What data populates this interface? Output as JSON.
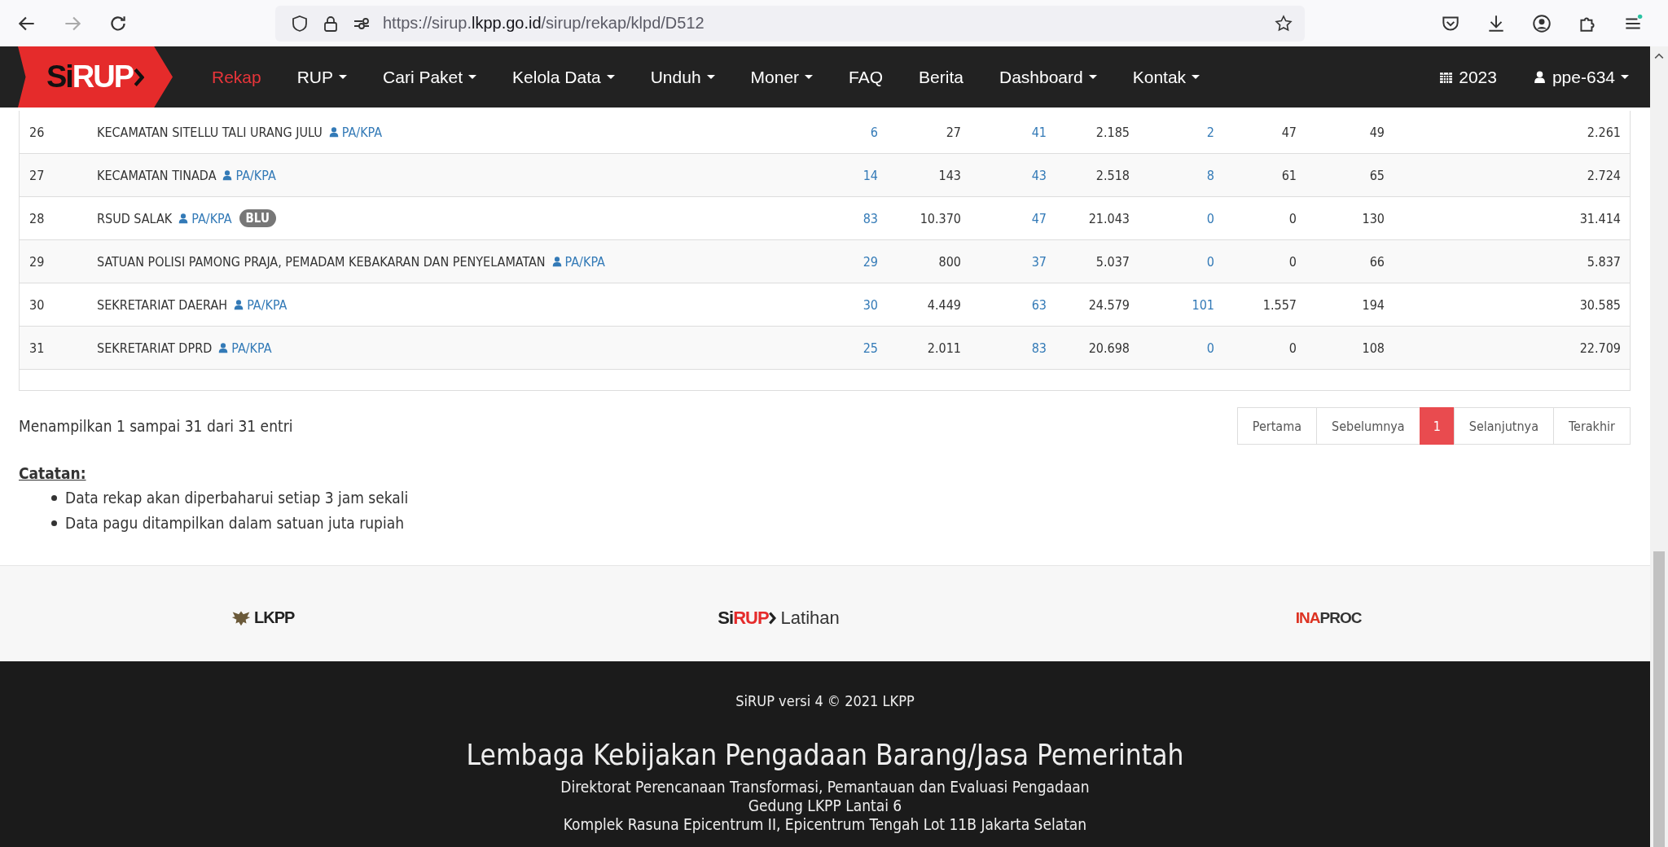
{
  "browser": {
    "url": "https://sirup.**lkpp.go.id**/sirup/rekap/klpd/D512",
    "back_disabled": false,
    "forward_disabled": true
  },
  "navbar": {
    "logo": {
      "dark": "Si",
      "light": "RUP"
    },
    "items": [
      {
        "label": "Rekap",
        "selected": true,
        "dropdown": false
      },
      {
        "label": "RUP",
        "selected": false,
        "dropdown": true
      },
      {
        "label": "Cari Paket",
        "selected": false,
        "dropdown": true
      },
      {
        "label": "Kelola Data",
        "selected": false,
        "dropdown": true
      },
      {
        "label": "Unduh",
        "selected": false,
        "dropdown": true
      },
      {
        "label": "Moner",
        "selected": false,
        "dropdown": true
      },
      {
        "label": "FAQ",
        "selected": false,
        "dropdown": false
      },
      {
        "label": "Berita",
        "selected": false,
        "dropdown": false
      },
      {
        "label": "Dashboard",
        "selected": false,
        "dropdown": true
      },
      {
        "label": "Kontak",
        "selected": false,
        "dropdown": true
      }
    ],
    "year": "2023",
    "user": "ppe-634"
  },
  "table": {
    "rows": [
      {
        "no": "26",
        "name": "KECAMATAN SITELLU TALI URANG JULU",
        "role": "PA/KPA",
        "cells": [
          {
            "text": "6",
            "kind": "link"
          },
          {
            "text": "27",
            "kind": "text"
          },
          {
            "text": "41",
            "kind": "link"
          },
          {
            "text": "2.185",
            "kind": "text"
          },
          {
            "text": "2",
            "kind": "link"
          },
          {
            "text": "47",
            "kind": "text"
          },
          {
            "text": "49",
            "kind": "text"
          },
          {
            "text": "2.261",
            "kind": "text"
          }
        ]
      },
      {
        "no": "27",
        "name": "KECAMATAN TINADA",
        "role": "PA/KPA",
        "cells": [
          {
            "text": "14",
            "kind": "link"
          },
          {
            "text": "143",
            "kind": "text"
          },
          {
            "text": "43",
            "kind": "link"
          },
          {
            "text": "2.518",
            "kind": "text"
          },
          {
            "text": "8",
            "kind": "link"
          },
          {
            "text": "61",
            "kind": "text"
          },
          {
            "text": "65",
            "kind": "text"
          },
          {
            "text": "2.724",
            "kind": "text"
          }
        ]
      },
      {
        "no": "28",
        "name": "RSUD SALAK",
        "role": "PA/KPA",
        "badge": "BLU",
        "cells": [
          {
            "text": "83",
            "kind": "link"
          },
          {
            "text": "10.370",
            "kind": "text"
          },
          {
            "text": "47",
            "kind": "link"
          },
          {
            "text": "21.043",
            "kind": "text"
          },
          {
            "text": "0",
            "kind": "link"
          },
          {
            "text": "0",
            "kind": "text"
          },
          {
            "text": "130",
            "kind": "text"
          },
          {
            "text": "31.414",
            "kind": "text"
          }
        ]
      },
      {
        "no": "29",
        "name": "SATUAN POLISI PAMONG PRAJA, PEMADAM KEBAKARAN DAN PENYELAMATAN",
        "role": "PA/KPA",
        "cells": [
          {
            "text": "29",
            "kind": "link"
          },
          {
            "text": "800",
            "kind": "text"
          },
          {
            "text": "37",
            "kind": "link"
          },
          {
            "text": "5.037",
            "kind": "text"
          },
          {
            "text": "0",
            "kind": "link"
          },
          {
            "text": "0",
            "kind": "text"
          },
          {
            "text": "66",
            "kind": "text"
          },
          {
            "text": "5.837",
            "kind": "text"
          }
        ]
      },
      {
        "no": "30",
        "name": "SEKRETARIAT DAERAH",
        "role": "PA/KPA",
        "cells": [
          {
            "text": "30",
            "kind": "link"
          },
          {
            "text": "4.449",
            "kind": "text"
          },
          {
            "text": "63",
            "kind": "link"
          },
          {
            "text": "24.579",
            "kind": "text"
          },
          {
            "text": "101",
            "kind": "link"
          },
          {
            "text": "1.557",
            "kind": "text"
          },
          {
            "text": "194",
            "kind": "text"
          },
          {
            "text": "30.585",
            "kind": "text"
          }
        ]
      },
      {
        "no": "31",
        "name": "SEKRETARIAT DPRD",
        "role": "PA/KPA",
        "cells": [
          {
            "text": "25",
            "kind": "link"
          },
          {
            "text": "2.011",
            "kind": "text"
          },
          {
            "text": "83",
            "kind": "link"
          },
          {
            "text": "20.698",
            "kind": "text"
          },
          {
            "text": "0",
            "kind": "link"
          },
          {
            "text": "0",
            "kind": "text"
          },
          {
            "text": "108",
            "kind": "text"
          },
          {
            "text": "22.709",
            "kind": "text"
          }
        ]
      }
    ],
    "info": "Menampilkan 1 sampai 31 dari 31 entri",
    "pagination": [
      {
        "label": "Pertama",
        "selected": false
      },
      {
        "label": "Sebelumnya",
        "selected": false
      },
      {
        "label": "1",
        "selected": true
      },
      {
        "label": "Selanjutnya",
        "selected": false
      },
      {
        "label": "Terakhir",
        "selected": false
      }
    ]
  },
  "notes": {
    "title": "Catatan:",
    "items": [
      "Data rekap akan diperbaharui setiap 3 jam sekali",
      "Data pagu ditampilkan dalam satuan juta rupiah"
    ]
  },
  "partners": {
    "lkpp": "LKPP",
    "sirup": {
      "dark": "Si",
      "red": "RUP",
      "suffix": "Latihan"
    },
    "inaproc": {
      "red": "INA",
      "dark": "PROC"
    }
  },
  "footer": {
    "copyright": "SiRUP versi 4 © 2021 LKPP",
    "title": "Lembaga Kebijakan Pengadaan Barang/Jasa Pemerintah",
    "lines": [
      "Direktorat Perencanaan Transformasi, Pemantauan dan Evaluasi Pengadaan",
      "Gedung LKPP Lantai 6",
      "Komplek Rasuna Epicentrum II, Epicentrum Tengah Lot 11B Jakarta Selatan"
    ]
  }
}
